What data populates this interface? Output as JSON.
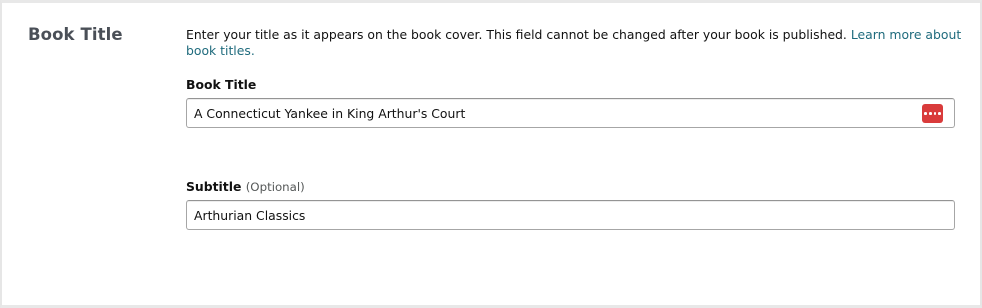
{
  "section": {
    "heading": "Book Title",
    "description": "Enter your title as it appears on the book cover. This field cannot be changed after your book is published.",
    "learn_more_link": "Learn more about book titles."
  },
  "fields": {
    "title": {
      "label": "Book Title",
      "value": "A Connecticut Yankee in King Arthur's Court",
      "action_icon": "dots-menu-icon",
      "action_icon_color": "#d93b3b"
    },
    "subtitle": {
      "label": "Subtitle",
      "optional_note": "(Optional)",
      "value": "Arthurian Classics"
    }
  }
}
